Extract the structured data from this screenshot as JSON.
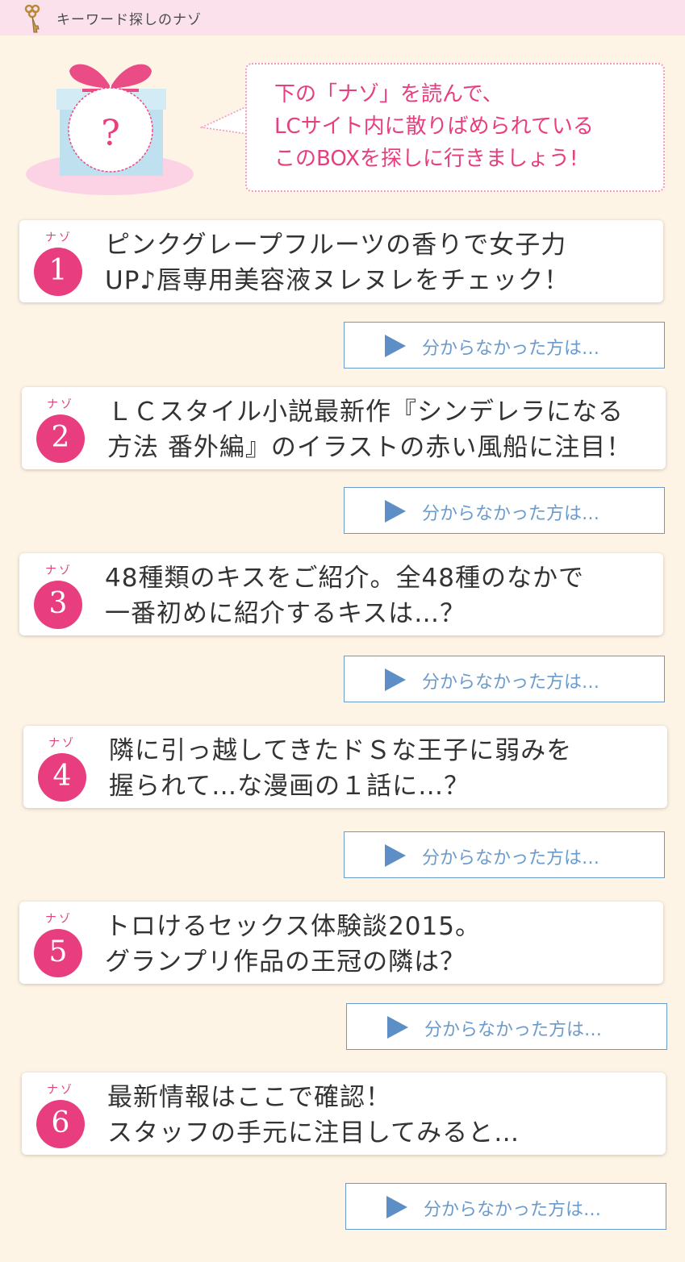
{
  "header": {
    "title": "キーワード探しのナゾ",
    "icon": "key-icon"
  },
  "hero": {
    "box_mark": "?",
    "bubble_lines": [
      "下の「ナゾ」を読んで、",
      "LCサイト内に散りばめられている",
      "このBOXを探しに行きましょう!"
    ]
  },
  "nazo_label": "ナゾ",
  "riddles": [
    {
      "number": "1",
      "lines": [
        "ピンクグレープフルーツの香りで女子力",
        "UP♪唇専用美容液ヌレヌレをチェック！"
      ]
    },
    {
      "number": "2",
      "lines": [
        "ＬＣスタイル小説最新作『シンデレラになる",
        "方法 番外編』のイラストの赤い風船に注目！"
      ]
    },
    {
      "number": "3",
      "lines": [
        "48種類のキスをご紹介。全48種のなかで",
        "一番初めに紹介するキスは…？"
      ]
    },
    {
      "number": "4",
      "lines": [
        "隣に引っ越してきたドＳな王子に弱みを",
        "握られて…な漫画の１話に…？"
      ]
    },
    {
      "number": "5",
      "lines": [
        "トロけるセックス体験談2015。",
        "グランプリ作品の王冠の隣は？"
      ]
    },
    {
      "number": "6",
      "lines": [
        "最新情報はここで確認！",
        "スタッフの手元に注目してみると…"
      ]
    }
  ],
  "hint_label": "分からなかった方は…",
  "colors": {
    "accent": "#e83d7e",
    "hint_blue": "#6b9bcb",
    "background": "#fdf4e6",
    "header": "#fbe1eb"
  }
}
